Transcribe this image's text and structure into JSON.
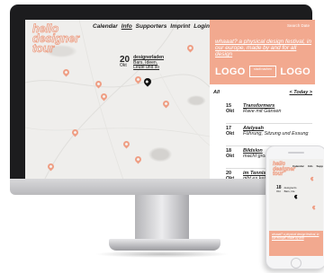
{
  "site": {
    "logo_lines": [
      "hello",
      "designer",
      "tour"
    ]
  },
  "nav": {
    "items": [
      "Calendar",
      "Info",
      "Supporters",
      "Imprint",
      "Login"
    ]
  },
  "map": {
    "event": {
      "day": "20",
      "month": "Okt",
      "title": "designerladen",
      "tags": "Bars, Ideen,",
      "tags2": "Leute und so"
    },
    "pin_color": "#ef9e84",
    "active_pin_color": "#111111"
  },
  "side": {
    "search_label": "Search Date",
    "tagline": "whaaat? a physical design festival, in our europe, made by and for all design",
    "logos": [
      "LOGO",
      "LOGO"
    ],
    "logo_mid_caption": "stadt nachen",
    "filter_all": "All",
    "filter_today": "< Today >",
    "events": [
      {
        "day": "15",
        "month": "Okt",
        "title": "Transformers",
        "desc": "Rave mit Gänsen"
      },
      {
        "day": "17",
        "month": "Okt",
        "title": "Atelyeah",
        "desc": "Führung, Sitzung und Essung"
      },
      {
        "day": "18",
        "month": "Okt",
        "title": "Bildslon",
        "desc": "macht großen Lärm"
      },
      {
        "day": "20",
        "month": "Okt",
        "title": "im TennisClub A",
        "desc": "gibt es keine Karten"
      }
    ],
    "accent_color": "#f2a98f"
  },
  "phone": {
    "logo_lines": [
      "hello",
      "designer",
      "tour"
    ],
    "nav": [
      "Calendar",
      "Info",
      "Supp"
    ],
    "event": {
      "day": "18",
      "month": "Okt",
      "title": "designerlo",
      "tags": "Bars, Ide"
    },
    "tagline": "whaaat? a physical design festival, in our europe, made by and"
  }
}
